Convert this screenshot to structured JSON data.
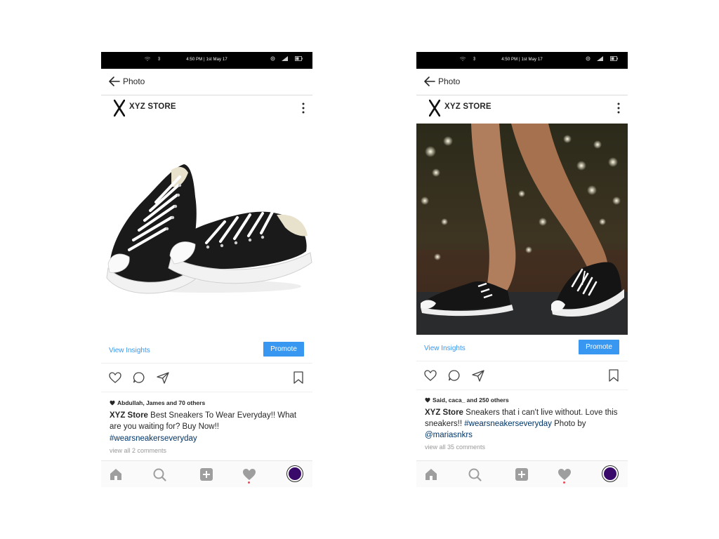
{
  "posts": [
    {
      "status_time": "4:50 PM | 1st May 17",
      "header_title": "Photo",
      "store_name": "XYZ STORE",
      "photo": "black-canvas-sneakers-product-shot",
      "view_insights": "View Insights",
      "promote": "Promote",
      "likes": "Abdullah, James and 70 others",
      "caption_user": "XYZ Store",
      "caption_text": "Best Sneakers To Wear Everyday!! What are you waiting for? Buy Now!!",
      "hashtag": "#wearsneakerseveryday",
      "view_comments": "view all 2 comments"
    },
    {
      "status_time": "4:50 PM | 1st May 17",
      "header_title": "Photo",
      "store_name": "XYZ STORE",
      "photo": "legs-wearing-sneakers-bokeh-night",
      "view_insights": "View Insights",
      "promote": "Promote",
      "likes": "Said, caca_ and 250 others",
      "caption_user": "XYZ Store",
      "caption_text": "Sneakers that i can't live without. Love this sneakers!!",
      "hashtag": "#wearsneakerseveryday",
      "caption_suffix": "Photo by",
      "mention": "@mariasnkrs",
      "view_comments": "view all 35 comments"
    }
  ],
  "icons": {
    "back": "arrow-left-icon",
    "more": "more-vertical-icon",
    "like": "heart-outline-icon",
    "comment": "comment-bubble-icon",
    "share": "paper-plane-icon",
    "save": "bookmark-icon",
    "home": "home-icon",
    "search": "search-icon",
    "add": "add-post-icon",
    "activity": "heart-filled-icon",
    "profile": "profile-avatar"
  },
  "colors": {
    "accent": "#3897f0",
    "link": "#003569",
    "notification": "#ed4956",
    "avatar": "#3a0a6b"
  }
}
